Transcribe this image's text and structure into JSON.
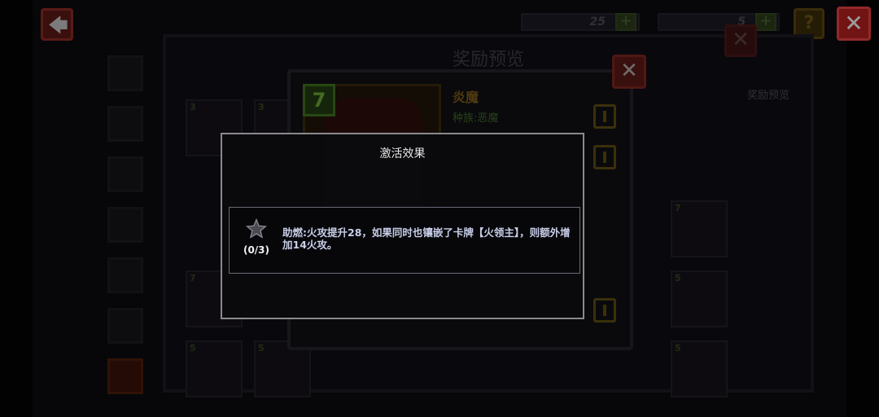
{
  "resources": {
    "gems": "25",
    "gold": "5"
  },
  "background_panel": {
    "title": "奖励预览",
    "reward_preview_label": "奖励预览"
  },
  "card": {
    "level": "7",
    "name": "炎魔",
    "race": "种族:恶魔"
  },
  "modal": {
    "title": "激活效果",
    "effect": {
      "progress": "(0/3)",
      "description": "助燃:火攻提升28，如果同时也镶嵌了卡牌【火领主】，则额外增加14火攻。",
      "icon": "star-icon"
    }
  },
  "colors": {
    "modal_border": "#8a8a8e",
    "effect_text": "#c8cee8",
    "card_name": "#7a5a16",
    "close_red": "#b02020"
  }
}
